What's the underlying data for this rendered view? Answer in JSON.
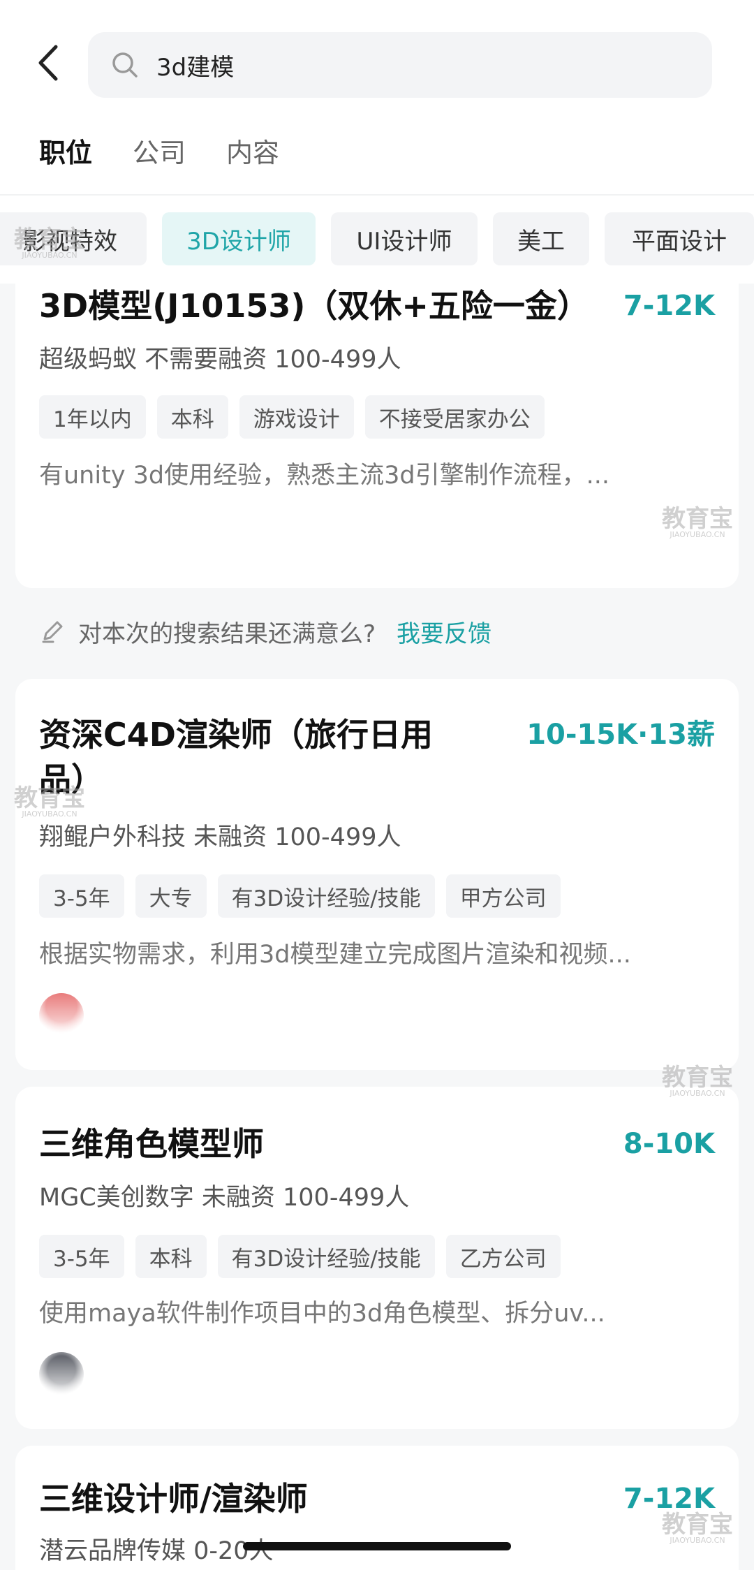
{
  "search": {
    "query": "3d建模"
  },
  "tabs": [
    {
      "label": "职位",
      "active": true
    },
    {
      "label": "公司",
      "active": false
    },
    {
      "label": "内容",
      "active": false
    }
  ],
  "filters": [
    {
      "label": "影视特效",
      "active": false
    },
    {
      "label": "3D设计师",
      "active": true
    },
    {
      "label": "UI设计师",
      "active": false
    },
    {
      "label": "美工",
      "active": false
    },
    {
      "label": "平面设计",
      "active": false
    }
  ],
  "jobs": [
    {
      "title": "3D模型(J10153)（双休+五险一金）",
      "salary": "7-12K",
      "company": "超级蚂蚁 不需要融资 100-499人",
      "tags": [
        "1年以内",
        "本科",
        "游戏设计",
        "不接受居家办公"
      ],
      "desc": "有unity 3d使用经验，熟悉主流3d引擎制作流程，..."
    },
    {
      "title_line1": "资深C4D渲染师（旅行日用",
      "title_line2": "品）",
      "salary": "10-15K·13薪",
      "company": "翔鲲户外科技 未融资 100-499人",
      "tags": [
        "3-5年",
        "大专",
        "有3D设计经验/技能",
        "甲方公司"
      ],
      "desc": "根据实物需求，利用3d模型建立完成图片渲染和视频..."
    },
    {
      "title": "三维角色模型师",
      "salary": "8-10K",
      "company": "MGC美创数字 未融资 100-499人",
      "tags": [
        "3-5年",
        "本科",
        "有3D设计经验/技能",
        "乙方公司"
      ],
      "desc": "使用maya软件制作项目中的3d角色模型、拆分uv..."
    },
    {
      "title": "三维设计师/渲染师",
      "salary": "7-12K",
      "company": "潜云品牌传媒 0-20人"
    }
  ],
  "feedback": {
    "question": "对本次的搜索结果还满意么?",
    "link": "我要反馈"
  },
  "watermark": {
    "cn": "教育宝",
    "en": "JIAOYUBAO.CN"
  },
  "colors": {
    "accent": "#1aa0a3",
    "chip_active_bg": "#e5f6f6"
  }
}
